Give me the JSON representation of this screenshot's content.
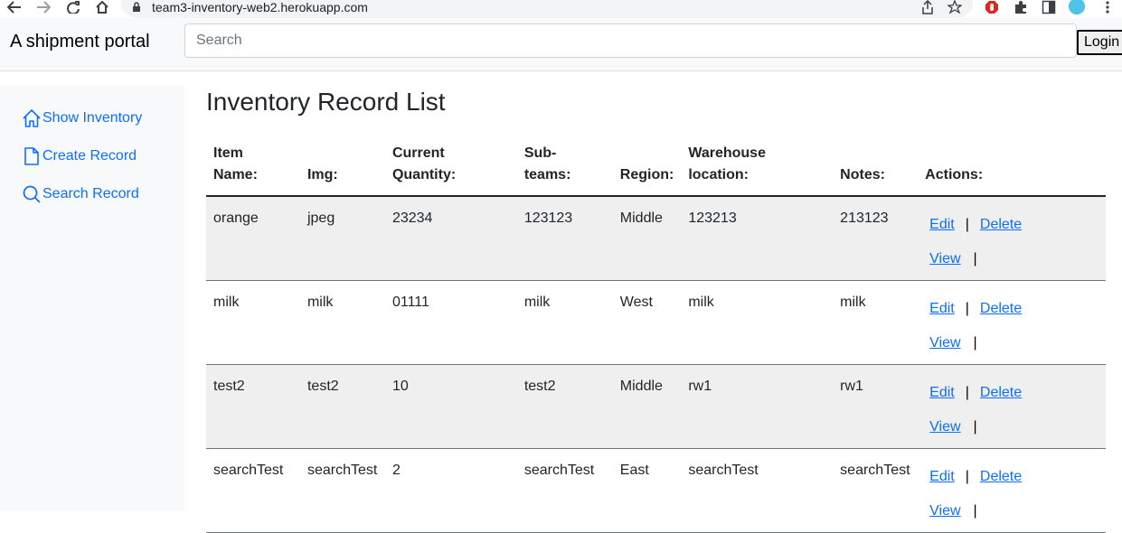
{
  "browser": {
    "url": "team3-inventory-web2.herokuapp.com"
  },
  "navbar": {
    "brand": "A shipment portal",
    "search_placeholder": "Search",
    "login_label": "Login"
  },
  "sidebar": {
    "items": [
      {
        "label": "Show Inventory",
        "icon": "home-icon"
      },
      {
        "label": "Create Record",
        "icon": "file-icon"
      },
      {
        "label": "Search Record",
        "icon": "search-icon"
      }
    ]
  },
  "main": {
    "title": "Inventory Record List",
    "columns": [
      {
        "line1": "Item",
        "line2": "Name:"
      },
      {
        "line1": "",
        "line2": "Img:"
      },
      {
        "line1": "Current",
        "line2": "Quantity:"
      },
      {
        "line1": "Sub-",
        "line2": "teams:"
      },
      {
        "line1": "",
        "line2": "Region:"
      },
      {
        "line1": "Warehouse",
        "line2": "location:"
      },
      {
        "line1": "",
        "line2": "Notes:"
      },
      {
        "line1": "",
        "line2": "Actions:"
      }
    ],
    "rows": [
      {
        "name": "orange",
        "img": "jpeg",
        "quantity": "23234",
        "subteams": "123123",
        "region": "Middle",
        "location": "123213",
        "notes": "213123"
      },
      {
        "name": "milk",
        "img": "milk",
        "quantity": "01111",
        "subteams": "milk",
        "region": "West",
        "location": "milk",
        "notes": "milk"
      },
      {
        "name": "test2",
        "img": "test2",
        "quantity": "10",
        "subteams": "test2",
        "region": "Middle",
        "location": "rw1",
        "notes": "rw1"
      },
      {
        "name": "searchTest",
        "img": "searchTest",
        "quantity": "2",
        "subteams": "searchTest",
        "region": "East",
        "location": "searchTest",
        "notes": "searchTest"
      }
    ],
    "actions": {
      "edit": "Edit",
      "delete": "Delete",
      "view": "View",
      "separator": "|"
    }
  },
  "colors": {
    "link": "#0d6efd",
    "stripe": "#efefef",
    "sidebar_bg": "#f8f9fa"
  }
}
